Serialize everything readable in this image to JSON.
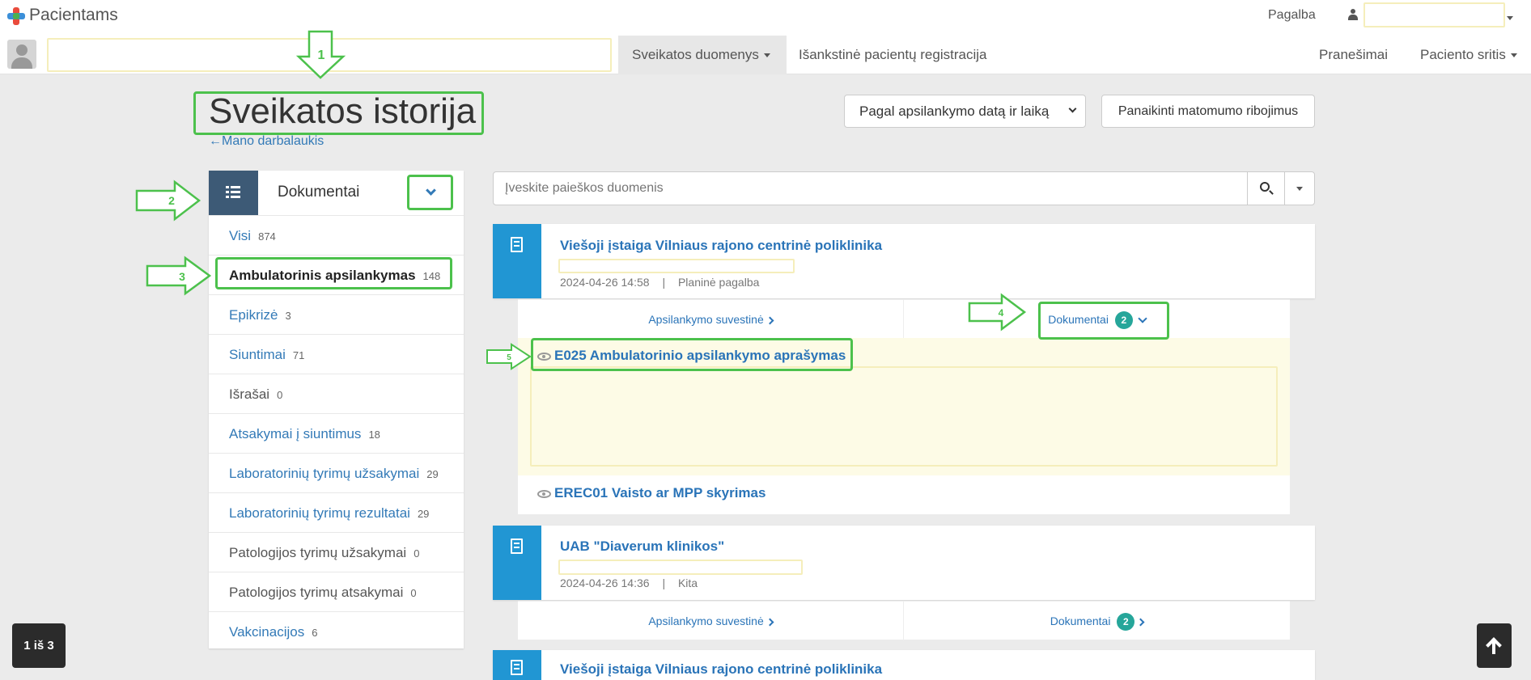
{
  "app": {
    "brand": "Pacientams",
    "help": "Pagalba"
  },
  "nav": {
    "health_data": "Sveikatos duomenys",
    "preregistration": "Išankstinė pacientų registracija",
    "messages": "Pranešimai",
    "patient_area": "Paciento sritis"
  },
  "page": {
    "title": "Sveikatos istorija",
    "back_link": "←Mano darbalaukis",
    "sort_select": "Pagal apsilankymo datą ir laiką",
    "clear_restrictions": "Panaikinti matomumo ribojimus"
  },
  "search": {
    "placeholder": "Įveskite paieškos duomenis"
  },
  "sidebar": {
    "title": "Dokumentai",
    "items": [
      {
        "label": "Visi",
        "count": "874"
      },
      {
        "label": "Ambulatorinis apsilankymas",
        "count": "148"
      },
      {
        "label": "Epikrizė",
        "count": "3"
      },
      {
        "label": "Siuntimai",
        "count": "71"
      },
      {
        "label": "Išrašai",
        "count": "0"
      },
      {
        "label": "Atsakymai į siuntimus",
        "count": "18"
      },
      {
        "label": "Laboratorinių tyrimų užsakymai",
        "count": "29"
      },
      {
        "label": "Laboratorinių tyrimų rezultatai",
        "count": "29"
      },
      {
        "label": "Patologijos tyrimų užsakymai",
        "count": "0"
      },
      {
        "label": "Patologijos tyrimų atsakymai",
        "count": "0"
      },
      {
        "label": "Vakcinacijos",
        "count": "6"
      }
    ]
  },
  "visits": [
    {
      "institution": "Viešoji įstaiga Vilniaus rajono centrinė poliklinika",
      "datetime": "2024-04-26 14:58",
      "type": "Planinė pagalba",
      "summary": "Apsilankymo suvestinė",
      "docs_label": "Dokumentai",
      "docs_count": "2"
    },
    {
      "institution": "UAB \"Diaverum klinikos\"",
      "datetime": "2024-04-26 14:36",
      "type": "Kita",
      "summary": "Apsilankymo suvestinė",
      "docs_label": "Dokumentai",
      "docs_count": "2"
    },
    {
      "institution": "Viešoji įstaiga Vilniaus rajono centrinė poliklinika"
    }
  ],
  "documents": [
    {
      "name": "E025 Ambulatorinio apsilankymo aprašymas"
    },
    {
      "name": "EREC01 Vaisto ar MPP skyrimas"
    }
  ],
  "meta_sep": "|",
  "pagination": {
    "label": "1 iš 3"
  },
  "annotations": [
    "1",
    "2",
    "3",
    "4",
    "5"
  ],
  "colors": {
    "accent": "#2196d3",
    "badge": "#26a69a",
    "annotation": "#4cc14c",
    "sidebar_icon_bg": "#3d5a76"
  }
}
